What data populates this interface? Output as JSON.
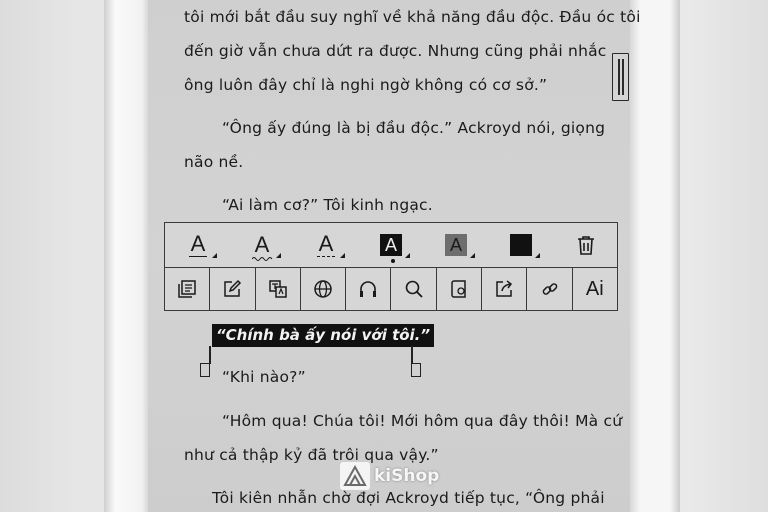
{
  "book": {
    "lines": [
      "tôi mới bắt đầu suy nghĩ về khả năng đầu độc. Đầu óc tôi",
      "đến giờ vẫn chưa dứt ra được. Nhưng cũng phải nhắc",
      "ông luôn đây chỉ là nghi ngờ không có cơ sở.”",
      "“Ông ấy đúng là bị đầu độc.”  Ackroyd nói, giọng",
      "não nề.",
      "“Ai làm cơ?”  Tôi kinh ngạc.",
      "“Khi nào?”",
      "“Hôm qua! Chúa tôi! Mới hôm qua đây thôi! Mà cứ",
      "như cả thập kỷ đã trôi qua vậy.”",
      "Tôi kiên nhẫn chờ đợi Ackroyd tiếp tục,  “Ông phải"
    ],
    "selected_text": "“Chính bà ấy nói với tôi.”"
  },
  "toolbar": {
    "style_glyph": "A",
    "styles": [
      "underline-solid",
      "underline-wavy",
      "underline-dashed",
      "highlight-black",
      "highlight-gray",
      "fill-black"
    ],
    "selected_style_index": 3,
    "actions": [
      "copy",
      "note",
      "translate",
      "search-web",
      "read-aloud",
      "search",
      "dictionary",
      "share",
      "link",
      "ai"
    ],
    "ai_label": "Ai"
  },
  "watermark": {
    "brand": "kiShop"
  },
  "colors": {
    "screen": "#d2d2d2",
    "ink": "#1b1b1b",
    "highlight_gray": "#6d6d6d"
  }
}
